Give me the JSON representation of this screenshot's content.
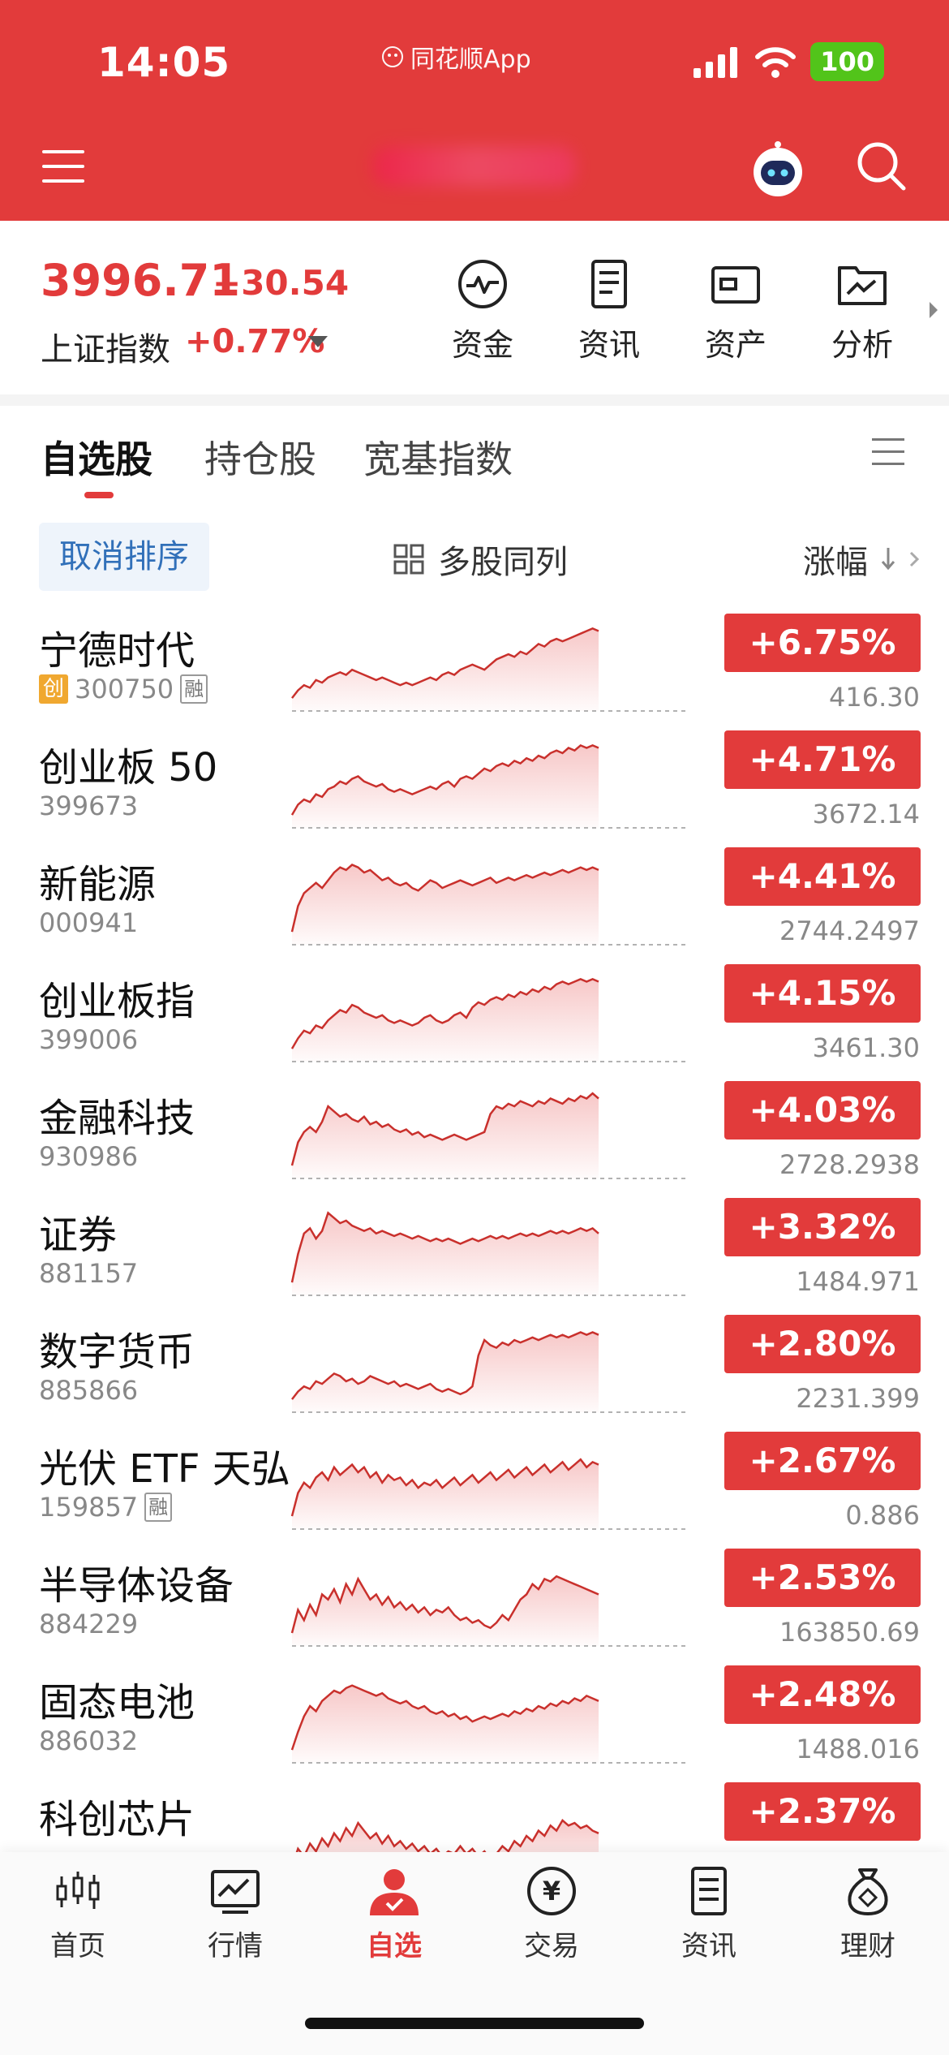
{
  "status": {
    "time": "14:05",
    "center": "同花顺App",
    "battery": "100"
  },
  "index": {
    "value": "3996.71",
    "change": "+30.54",
    "name": "上证指数",
    "pct": "+0.77%"
  },
  "quick": [
    {
      "label": "资金",
      "icon": "pulse-icon"
    },
    {
      "label": "资讯",
      "icon": "document-icon"
    },
    {
      "label": "资产",
      "icon": "card-icon"
    },
    {
      "label": "分析",
      "icon": "chart-folder-icon"
    }
  ],
  "tabs": [
    "自选股",
    "持仓股",
    "宽基指数"
  ],
  "toolbar": {
    "sort_cancel": "取消排序",
    "multi": "多股同列",
    "sort_col": "涨幅"
  },
  "rows": [
    {
      "name": "宁德时代",
      "code": "300750",
      "chuang": true,
      "rong": true,
      "pct": "+6.75%",
      "price": "416.30",
      "spark": [
        5,
        8,
        10,
        9,
        12,
        11,
        13,
        14,
        15,
        14,
        16,
        15,
        14,
        13,
        12,
        13,
        12,
        11,
        10,
        11,
        10,
        11,
        12,
        13,
        12,
        14,
        15,
        14,
        16,
        17,
        18,
        17,
        16,
        18,
        20,
        21,
        22,
        21,
        23,
        22,
        24,
        26,
        25,
        27,
        28,
        27,
        28,
        29,
        30,
        31,
        32,
        31
      ]
    },
    {
      "name": "创业板 50",
      "code": "399673",
      "chuang": false,
      "rong": false,
      "pct": "+4.71%",
      "price": "3672.14",
      "spark": [
        5,
        9,
        11,
        10,
        13,
        12,
        15,
        16,
        18,
        17,
        19,
        20,
        18,
        17,
        16,
        17,
        15,
        14,
        15,
        14,
        13,
        14,
        15,
        16,
        15,
        17,
        18,
        16,
        19,
        20,
        19,
        21,
        23,
        22,
        24,
        25,
        24,
        26,
        25,
        27,
        26,
        28,
        27,
        29,
        30,
        29,
        31,
        30,
        32,
        31,
        32,
        31
      ]
    },
    {
      "name": "新能源",
      "code": "000941",
      "chuang": false,
      "rong": false,
      "pct": "+4.41%",
      "price": "2744.2497",
      "spark": [
        5,
        15,
        20,
        22,
        24,
        22,
        25,
        28,
        30,
        29,
        31,
        30,
        28,
        29,
        27,
        25,
        26,
        24,
        23,
        24,
        22,
        21,
        23,
        25,
        24,
        22,
        23,
        24,
        25,
        24,
        23,
        24,
        25,
        26,
        24,
        25,
        26,
        25,
        26,
        27,
        26,
        27,
        28,
        27,
        28,
        29,
        28,
        29,
        30,
        29,
        30,
        29
      ]
    },
    {
      "name": "创业板指",
      "code": "399006",
      "chuang": false,
      "rong": false,
      "pct": "+4.15%",
      "price": "3461.30",
      "spark": [
        5,
        9,
        12,
        11,
        14,
        13,
        16,
        18,
        20,
        19,
        22,
        21,
        19,
        18,
        17,
        18,
        16,
        15,
        16,
        15,
        14,
        15,
        17,
        18,
        16,
        15,
        16,
        18,
        19,
        17,
        21,
        23,
        22,
        24,
        25,
        24,
        26,
        25,
        27,
        26,
        28,
        27,
        29,
        28,
        30,
        31,
        30,
        31,
        32,
        31,
        32,
        31
      ]
    },
    {
      "name": "金融科技",
      "code": "930986",
      "chuang": false,
      "rong": false,
      "pct": "+4.03%",
      "price": "2728.2938",
      "spark": [
        5,
        14,
        18,
        20,
        18,
        22,
        28,
        26,
        24,
        25,
        23,
        22,
        24,
        21,
        22,
        20,
        21,
        19,
        18,
        19,
        17,
        18,
        16,
        17,
        16,
        15,
        16,
        17,
        16,
        15,
        16,
        17,
        18,
        25,
        28,
        27,
        29,
        28,
        30,
        29,
        28,
        30,
        29,
        31,
        30,
        29,
        31,
        30,
        32,
        31,
        33,
        31
      ]
    },
    {
      "name": "证券",
      "code": "881157",
      "chuang": false,
      "rong": false,
      "pct": "+3.32%",
      "price": "1484.971",
      "spark": [
        5,
        16,
        24,
        26,
        22,
        25,
        32,
        30,
        28,
        29,
        27,
        26,
        25,
        26,
        24,
        25,
        24,
        23,
        24,
        23,
        22,
        23,
        22,
        21,
        22,
        21,
        22,
        21,
        20,
        21,
        22,
        21,
        22,
        23,
        22,
        23,
        22,
        23,
        24,
        23,
        24,
        23,
        24,
        25,
        24,
        25,
        24,
        25,
        26,
        25,
        26,
        24
      ]
    },
    {
      "name": "数字货币",
      "code": "885866",
      "chuang": false,
      "rong": false,
      "pct": "+2.80%",
      "price": "2231.399",
      "spark": [
        5,
        8,
        10,
        9,
        12,
        11,
        13,
        15,
        14,
        12,
        13,
        11,
        12,
        14,
        13,
        12,
        11,
        12,
        10,
        11,
        10,
        9,
        10,
        11,
        9,
        8,
        9,
        8,
        7,
        8,
        10,
        22,
        28,
        26,
        25,
        27,
        26,
        28,
        27,
        28,
        29,
        28,
        29,
        30,
        29,
        30,
        29,
        30,
        31,
        30,
        31,
        30
      ]
    },
    {
      "name": "光伏 ETF 天弘",
      "code": "159857",
      "chuang": false,
      "rong": true,
      "pct": "+2.67%",
      "price": "0.886",
      "spark": [
        5,
        14,
        18,
        16,
        20,
        22,
        19,
        24,
        21,
        23,
        25,
        22,
        24,
        20,
        22,
        18,
        21,
        19,
        20,
        17,
        19,
        16,
        18,
        17,
        19,
        16,
        18,
        20,
        17,
        19,
        21,
        18,
        20,
        22,
        19,
        21,
        23,
        20,
        22,
        24,
        21,
        23,
        25,
        22,
        24,
        26,
        23,
        25,
        27,
        24,
        26,
        25
      ]
    },
    {
      "name": "半导体设备",
      "code": "884229",
      "chuang": false,
      "rong": false,
      "pct": "+2.53%",
      "price": "163850.69",
      "spark": [
        5,
        14,
        10,
        16,
        12,
        20,
        18,
        22,
        17,
        24,
        20,
        26,
        22,
        18,
        20,
        16,
        19,
        15,
        17,
        14,
        16,
        13,
        15,
        12,
        14,
        13,
        15,
        12,
        10,
        11,
        9,
        10,
        8,
        7,
        9,
        12,
        10,
        14,
        18,
        20,
        24,
        22,
        26,
        25,
        27,
        26,
        25,
        24,
        23,
        22,
        21,
        20
      ]
    },
    {
      "name": "固态电池",
      "code": "886032",
      "chuang": false,
      "rong": false,
      "pct": "+2.48%",
      "price": "1488.016",
      "spark": [
        5,
        12,
        18,
        22,
        20,
        24,
        26,
        28,
        27,
        29,
        30,
        29,
        28,
        27,
        26,
        27,
        25,
        24,
        23,
        24,
        22,
        21,
        22,
        20,
        19,
        20,
        18,
        19,
        17,
        18,
        16,
        17,
        18,
        17,
        18,
        19,
        18,
        20,
        19,
        21,
        20,
        22,
        21,
        23,
        22,
        24,
        23,
        25,
        24,
        26,
        25,
        24
      ]
    },
    {
      "name": "科创芯片",
      "code": "",
      "chuang": false,
      "rong": false,
      "pct": "+2.37%",
      "price": "",
      "spark": [
        5,
        12,
        9,
        14,
        11,
        16,
        13,
        18,
        15,
        20,
        17,
        22,
        19,
        16,
        18,
        14,
        17,
        13,
        15,
        12,
        14,
        11,
        13,
        10,
        12,
        9,
        11,
        10,
        13,
        10,
        12,
        9,
        11,
        8,
        10,
        13,
        11,
        15,
        13,
        17,
        15,
        19,
        17,
        21,
        19,
        23,
        21,
        22,
        20,
        21,
        19,
        18
      ]
    }
  ],
  "nav": [
    {
      "label": "首页",
      "icon": "candlestick-icon"
    },
    {
      "label": "行情",
      "icon": "market-icon"
    },
    {
      "label": "自选",
      "icon": "watchlist-user-icon"
    },
    {
      "label": "交易",
      "icon": "yen-icon"
    },
    {
      "label": "资讯",
      "icon": "news-icon"
    },
    {
      "label": "理财",
      "icon": "money-bag-icon"
    }
  ],
  "colors": {
    "brand": "#e23b3b",
    "up": "#e23b3b",
    "link": "#3170b9"
  }
}
